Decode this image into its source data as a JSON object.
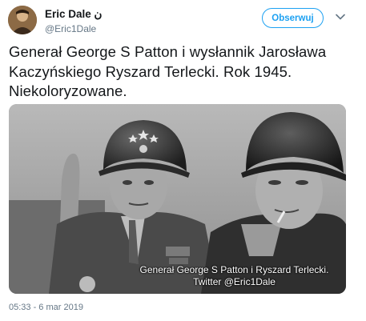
{
  "tweet": {
    "author": {
      "display_name": "Eric Dale ن",
      "handle": "@Eric1Dale"
    },
    "follow_label": "Obserwuj",
    "text": "Generał George S Patton i wysłannik Jarosława Kaczyńskiego Ryszard Terlecki. Rok 1945. Niekoloryzowane.",
    "media": {
      "caption_line1": "Generał George S Patton i Ryszard Terlecki.",
      "caption_line2": "Twitter @Eric1Dale"
    },
    "timestamp": "05:33 - 6 mar 2019"
  },
  "colors": {
    "accent": "#1da1f2",
    "secondary_text": "#657786",
    "primary_text": "#14171a"
  },
  "icons": {
    "avatar": "avatar-photo",
    "more": "chevron-down-icon"
  }
}
